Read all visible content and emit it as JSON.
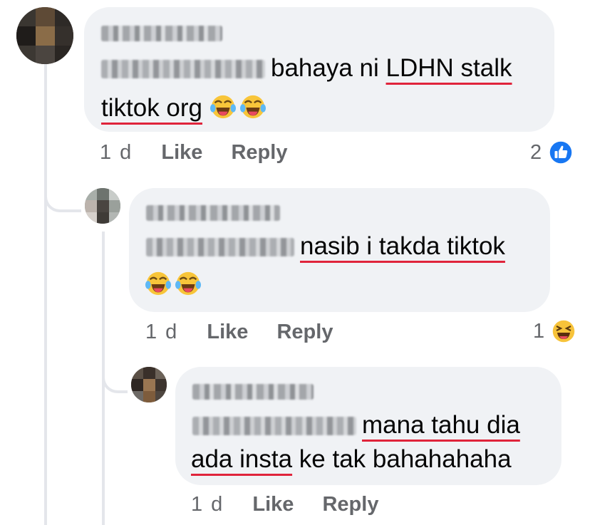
{
  "comments": [
    {
      "mention_text": "bahaya ni",
      "line1_underlined": "LDHN stalk",
      "line2_underlined": "tiktok org",
      "time": "1 d",
      "like_label": "Like",
      "reply_label": "Reply",
      "reaction_count": "2",
      "reaction_icon": "like-icon",
      "reaction_color": "#1877f2"
    },
    {
      "line1_underlined": "nasib i takda tiktok",
      "time": "1 d",
      "like_label": "Like",
      "reply_label": "Reply",
      "reaction_count": "1",
      "reaction_icon": "haha-icon"
    },
    {
      "line1_underlined": "mana tahu dia",
      "line2_underlined": "ada insta",
      "line2_rest": "ke tak bahahahaha",
      "time": "1 d",
      "like_label": "Like",
      "reply_label": "Reply"
    }
  ],
  "colors": {
    "bubble": "#f0f2f5",
    "underline": "#e0243b",
    "meta": "#65676b"
  }
}
